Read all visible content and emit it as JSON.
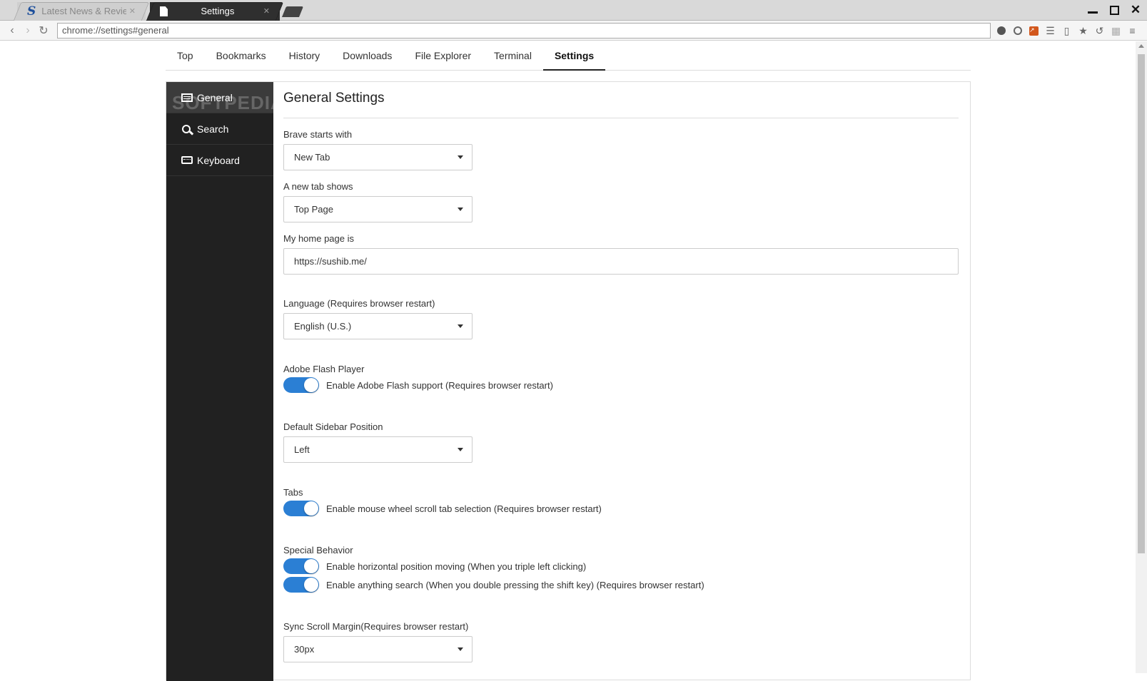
{
  "browser": {
    "tabs": [
      {
        "title": "Latest News & Reviews",
        "active": false
      },
      {
        "title": "Settings",
        "active": true
      }
    ],
    "address": "chrome://settings#general"
  },
  "topnav": [
    "Top",
    "Bookmarks",
    "History",
    "Downloads",
    "File Explorer",
    "Terminal",
    "Settings"
  ],
  "sidebar": {
    "watermark": "SOFTPEDIA",
    "items": [
      {
        "label": "General",
        "icon": "list-icon"
      },
      {
        "label": "Search",
        "icon": "search-icon"
      },
      {
        "label": "Keyboard",
        "icon": "keyboard-icon"
      }
    ]
  },
  "general": {
    "title": "General Settings",
    "starts_with": {
      "label": "Brave starts with",
      "value": "New Tab"
    },
    "new_tab": {
      "label": "A new tab shows",
      "value": "Top Page"
    },
    "home_page": {
      "label": "My home page is",
      "value": "https://sushib.me/"
    },
    "language": {
      "label": "Language (Requires browser restart)",
      "value": "English (U.S.)"
    },
    "flash": {
      "label": "Adobe Flash Player",
      "toggle": "Enable Adobe Flash support (Requires browser restart)",
      "on": true
    },
    "sidebar_position": {
      "label": "Default Sidebar Position",
      "value": "Left"
    },
    "tabs": {
      "label": "Tabs",
      "toggle": "Enable mouse wheel scroll tab selection (Requires browser restart)",
      "on": true
    },
    "special": {
      "label": "Special Behavior",
      "toggles": [
        {
          "text": "Enable horizontal position moving (When you triple left clicking)",
          "on": true
        },
        {
          "text": "Enable anything search (When you double pressing the shift key) (Requires browser restart)",
          "on": true
        }
      ]
    },
    "sync_scroll": {
      "label": "Sync Scroll Margin(Requires browser restart)",
      "value": "30px"
    }
  },
  "colors": {
    "toggle_on": "#2b7fd4",
    "sidebar_bg": "#212121"
  }
}
